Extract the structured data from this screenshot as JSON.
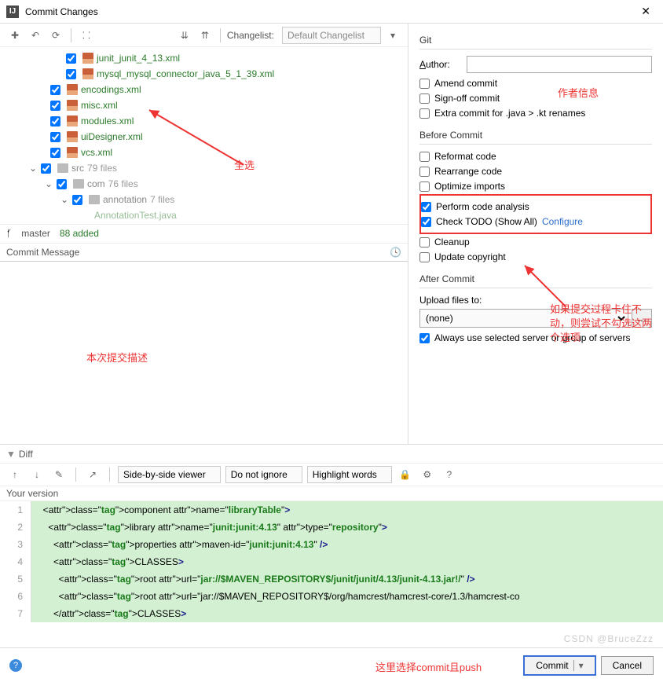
{
  "window": {
    "title": "Commit Changes"
  },
  "toolbar": {
    "changelist_label": "Changelist:",
    "changelist_value": "Default Changelist"
  },
  "tree": {
    "items": [
      {
        "indent": 80,
        "name": "junit_junit_4_13.xml"
      },
      {
        "indent": 80,
        "name": "mysql_mysql_connector_java_5_1_39.xml"
      },
      {
        "indent": 60,
        "name": "encodings.xml"
      },
      {
        "indent": 60,
        "name": "misc.xml"
      },
      {
        "indent": 60,
        "name": "modules.xml"
      },
      {
        "indent": 60,
        "name": "uiDesigner.xml"
      },
      {
        "indent": 60,
        "name": "vcs.xml"
      }
    ],
    "folders": [
      {
        "indent": 40,
        "name": "src",
        "count": "79 files"
      },
      {
        "indent": 60,
        "name": "com",
        "count": "76 files"
      },
      {
        "indent": 80,
        "name": "annotation",
        "count": "7 files"
      }
    ],
    "cutoff": "AnnotationTest.java"
  },
  "branch": {
    "name": "master",
    "status": "88 added"
  },
  "commit_msg": {
    "label": "Commit Message"
  },
  "git": {
    "title": "Git",
    "author_label": "Author:",
    "amend": "Amend commit",
    "signoff": "Sign-off commit",
    "extra": "Extra commit for .java > .kt renames"
  },
  "before": {
    "title": "Before Commit",
    "reformat": "Reformat code",
    "rearrange": "Rearrange code",
    "optimize": "Optimize imports",
    "analysis": "Perform code analysis",
    "todo": "Check TODO (Show All)",
    "configure": "Configure",
    "cleanup": "Cleanup",
    "copyright": "Update copyright"
  },
  "after": {
    "title": "After Commit",
    "upload_label": "Upload files to:",
    "upload_value": "(none)",
    "always": "Always use selected server or group of servers"
  },
  "diff": {
    "label": "Diff",
    "viewer": "Side-by-side viewer",
    "ignore": "Do not ignore",
    "highlight": "Highlight words",
    "your_version": "Your version"
  },
  "code": {
    "lines": [
      {
        "n": "1",
        "indent": 1,
        "raw": "<component name=\"libraryTable\">"
      },
      {
        "n": "2",
        "indent": 2,
        "raw": "<library name=\"junit:junit:4.13\" type=\"repository\">"
      },
      {
        "n": "3",
        "indent": 3,
        "raw": "<properties maven-id=\"junit:junit:4.13\" />"
      },
      {
        "n": "4",
        "indent": 3,
        "raw": "<CLASSES>"
      },
      {
        "n": "5",
        "indent": 4,
        "raw": "<root url=\"jar://$MAVEN_REPOSITORY$/junit/junit/4.13/junit-4.13.jar!/\" />"
      },
      {
        "n": "6",
        "indent": 4,
        "raw": "<root url=\"jar://$MAVEN_REPOSITORY$/org/hamcrest/hamcrest-core/1.3/hamcrest-co"
      },
      {
        "n": "7",
        "indent": 3,
        "raw": "</CLASSES>"
      }
    ]
  },
  "footer": {
    "commit": "Commit",
    "cancel": "Cancel"
  },
  "annot": {
    "all": "全选",
    "author": "作者信息",
    "desc": "本次提交描述",
    "stuck": "如果提交过程卡住不动，则尝试不勾选这两个选项",
    "push": "这里选择commit且push"
  },
  "watermark": "CSDN @BruceZzz"
}
